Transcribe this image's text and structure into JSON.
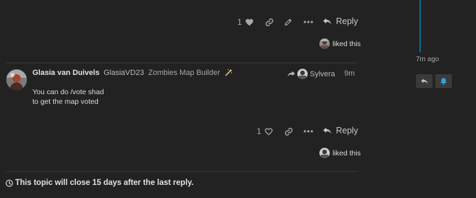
{
  "post1": {
    "like_count": "1",
    "reply_label": "Reply",
    "liked_text": "liked this",
    "icons": [
      "heart-icon",
      "link-icon",
      "pencil-icon",
      "more-icon",
      "reply-icon"
    ]
  },
  "post2": {
    "author_name": "Glasia van Duivels",
    "username": "GlasiaVD23",
    "user_title": "Zombies Map Builder",
    "reply_to_user": "Sylvera",
    "time_ago": "9m",
    "body_lines": [
      "You can do /vote shad",
      "to get the map voted"
    ],
    "like_count": "1",
    "reply_label": "Reply",
    "liked_text": "liked this"
  },
  "topic_notice": "This topic will close 15 days after the last reply.",
  "timeline": {
    "time_ago": "7m ago"
  },
  "colors": {
    "background": "#222222",
    "accent": "#0e6a95",
    "muted_text": "#a8a8a8"
  }
}
